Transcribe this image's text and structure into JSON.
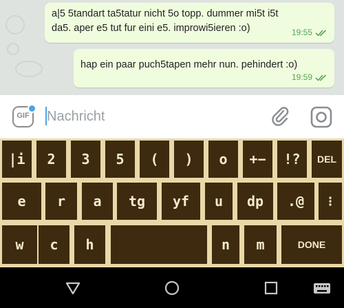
{
  "chat": {
    "messages": [
      {
        "text": "a|5 5tandart ta5tatur nicht 5o topp. dummer mi5t i5t da5. aper e5 tut fur eini e5. improwi5ieren :o)",
        "time": "19:55",
        "status_icon": "double-check-icon"
      },
      {
        "text": "hap ein paar puch5tapen mehr nun. pehindert :o)",
        "time": "19:59",
        "status_icon": "double-check-icon"
      }
    ]
  },
  "input_bar": {
    "gif_label": "GIF",
    "placeholder": "Nachricht",
    "icons": [
      "gif-icon",
      "paperclip-icon",
      "camera-icon"
    ]
  },
  "keyboard": {
    "rows": [
      [
        "|i",
        "2",
        "3",
        "5",
        "(",
        ")",
        "o",
        "+−",
        "!?",
        "DEL"
      ],
      [
        "e",
        "r",
        "a",
        "tg",
        "yf",
        "u",
        "dp",
        ".@",
        "⁝"
      ],
      [
        "w",
        "c",
        "h",
        "",
        "n",
        "m",
        "DONE"
      ]
    ]
  },
  "navbar": {
    "icons": [
      "back-triangle-icon",
      "home-circle-icon",
      "recents-square-icon",
      "keyboard-switch-icon"
    ]
  },
  "colors": {
    "chat_bg": "#dfe3e0",
    "bubble_bg": "#effdde",
    "meta_green": "#5aa35a",
    "accent_blue": "#4ea3e6",
    "key_bg": "#3e2a0e",
    "key_text": "#f4ead2",
    "keyboard_bg": "#e9d8a8",
    "navbar_bg": "#000000"
  }
}
